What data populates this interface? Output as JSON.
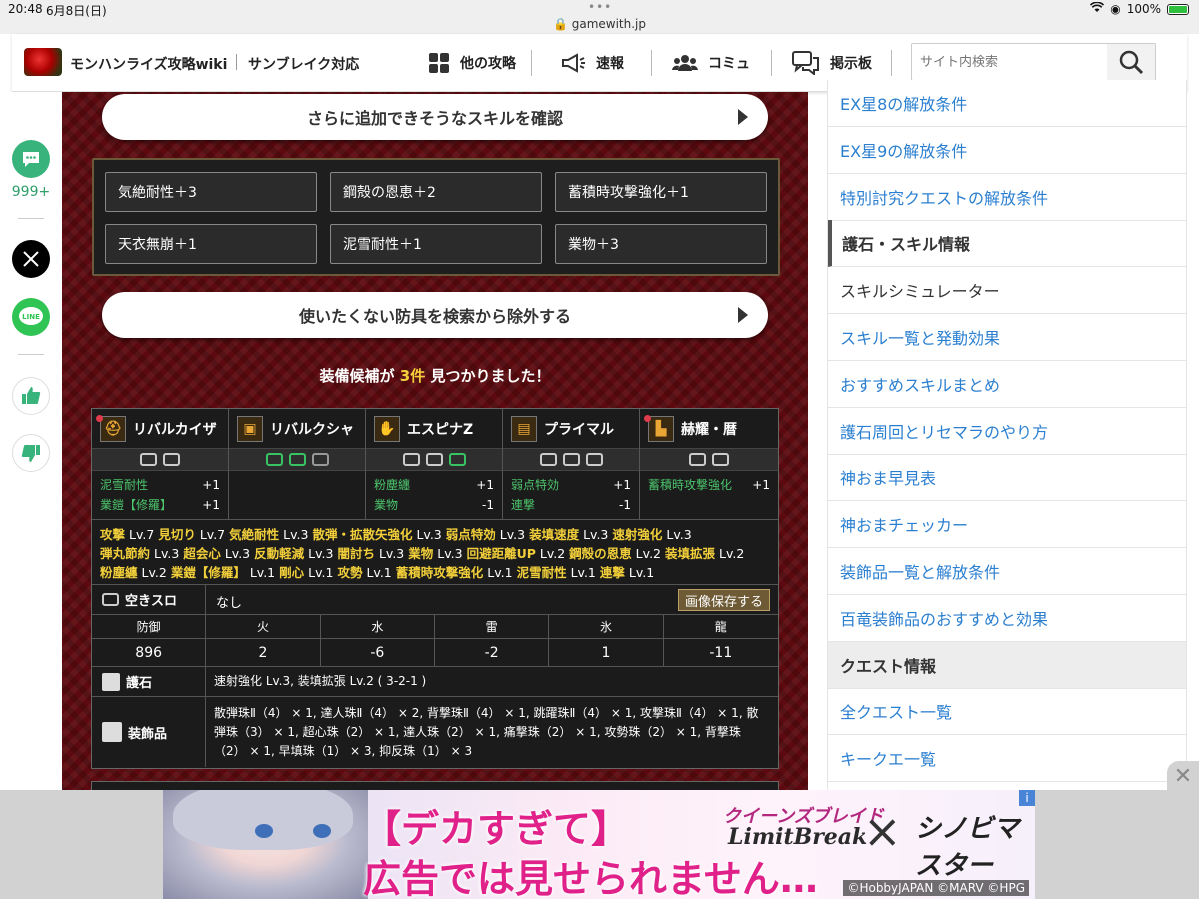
{
  "status_bar": {
    "time": "20:48",
    "date": "6月8日(日)",
    "url": "gamewith.jp",
    "battery": "100%"
  },
  "header": {
    "site_title": "モンハンライズ攻略wiki",
    "site_subtitle": "サンブレイク対応",
    "nav": [
      {
        "label": "他の攻略",
        "icon": "grid-icon"
      },
      {
        "label": "速報",
        "icon": "megaphone-icon"
      },
      {
        "label": "コミュ",
        "icon": "people-icon"
      },
      {
        "label": "掲示板",
        "icon": "chat-icon"
      }
    ],
    "search_placeholder": "サイト内検索"
  },
  "left_share": {
    "comment_count": "999+"
  },
  "main": {
    "more_skills_button": "さらに追加できそうなスキルを確認",
    "extra_skills": [
      "気絶耐性＋3",
      "鋼殻の恩恵＋2",
      "蓄積時攻撃強化＋1",
      "天衣無崩＋1",
      "泥雪耐性＋1",
      "業物＋3"
    ],
    "exclude_button": "使いたくない防具を検索から除外する",
    "found_prefix": "装備候補が",
    "found_count": "3件",
    "found_suffix": "見つかりました！",
    "armor": [
      {
        "name": "リバルカイザ",
        "skills": [
          [
            "泥雪耐性",
            "+1"
          ],
          [
            "業鎧【修羅】",
            "+1"
          ]
        ]
      },
      {
        "name": "リバルクシャ",
        "skills": []
      },
      {
        "name": "エスピナZ",
        "skills": [
          [
            "粉塵纏",
            "+1"
          ],
          [
            "業物",
            "-1"
          ]
        ]
      },
      {
        "name": "プライマル",
        "skills": [
          [
            "弱点特効",
            "+1"
          ],
          [
            "連撃",
            "-1"
          ]
        ]
      },
      {
        "name": "赫耀・暦",
        "skills": [
          [
            "蓄積時攻撃強化",
            "+1"
          ]
        ]
      }
    ],
    "total_skills": [
      [
        "攻撃",
        "Lv.7"
      ],
      [
        "見切り",
        "Lv.7"
      ],
      [
        "気絶耐性",
        "Lv.3"
      ],
      [
        "散弾・拡散矢強化",
        "Lv.3"
      ],
      [
        "弱点特効",
        "Lv.3"
      ],
      [
        "装填速度",
        "Lv.3"
      ],
      [
        "速射強化",
        "Lv.3"
      ],
      [
        "弾丸節約",
        "Lv.3"
      ],
      [
        "超会心",
        "Lv.3"
      ],
      [
        "反動軽減",
        "Lv.3"
      ],
      [
        "闇討ち",
        "Lv.3"
      ],
      [
        "業物",
        "Lv.3"
      ],
      [
        "回避距離UP",
        "Lv.2"
      ],
      [
        "鋼殻の恩恵",
        "Lv.2"
      ],
      [
        "装填拡張",
        "Lv.2"
      ],
      [
        "粉塵纏",
        "Lv.2"
      ],
      [
        "業鎧【修羅】",
        "Lv.1"
      ],
      [
        "剛心",
        "Lv.1"
      ],
      [
        "攻勢",
        "Lv.1"
      ],
      [
        "蓄積時攻撃強化",
        "Lv.1"
      ],
      [
        "泥雪耐性",
        "Lv.1"
      ],
      [
        "連撃",
        "Lv.1"
      ]
    ],
    "empty_slot_label": "空きスロ",
    "empty_slot_value": "なし",
    "save_image_button": "画像保存する",
    "defense_headers": [
      "防御",
      "火",
      "水",
      "雷",
      "氷",
      "龍"
    ],
    "defense_values": [
      "896",
      "2",
      "-6",
      "-2",
      "1",
      "-11"
    ],
    "charm_label": "護石",
    "charm_value": "速射強化 Lv.3, 装填拡張 Lv.2 ( 3-2-1 )",
    "deco_label": "装飾品",
    "deco_value": "散弾珠Ⅱ（4） × 1, 達人珠Ⅱ（4） × 2, 背撃珠Ⅱ（4） × 1, 跳躍珠Ⅱ（4） × 1, 攻撃珠Ⅱ（4） × 1, 散弾珠（3） × 1, 超心珠（2） × 1, 達人珠（2） × 1, 痛撃珠（2） × 1, 攻勢珠（2） × 1, 背撃珠（2） × 1, 早填珠（1） × 3, 抑反珠（1） × 3"
  },
  "sidebar": {
    "items": [
      {
        "label": "EX星8の解放条件",
        "type": "link"
      },
      {
        "label": "EX星9の解放条件",
        "type": "link"
      },
      {
        "label": "特別討究クエストの解放条件",
        "type": "link"
      },
      {
        "label": "護石・スキル情報",
        "type": "active"
      },
      {
        "label": "スキルシミュレーター",
        "type": "plain"
      },
      {
        "label": "スキル一覧と発動効果",
        "type": "link"
      },
      {
        "label": "おすすめスキルまとめ",
        "type": "link"
      },
      {
        "label": "護石周回とリセマラのやり方",
        "type": "link"
      },
      {
        "label": "神おま早見表",
        "type": "link"
      },
      {
        "label": "神おまチェッカー",
        "type": "link"
      },
      {
        "label": "装飾品一覧と解放条件",
        "type": "link"
      },
      {
        "label": "百竜装飾品のおすすめと効果",
        "type": "link"
      },
      {
        "label": "クエスト情報",
        "type": "head"
      },
      {
        "label": "全クエスト一覧",
        "type": "link"
      },
      {
        "label": "キークエ一覧",
        "type": "link"
      }
    ]
  },
  "ad": {
    "line1": "【デカすぎて】",
    "line2": "広告では見せられません…",
    "brand1_top": "クイーンズブレイド",
    "brand1_bottom": "LimitBreak",
    "brand2": "シノビマスター",
    "copyright": "©HobbyJAPAN ©MARV ©HPG",
    "info": "i"
  }
}
